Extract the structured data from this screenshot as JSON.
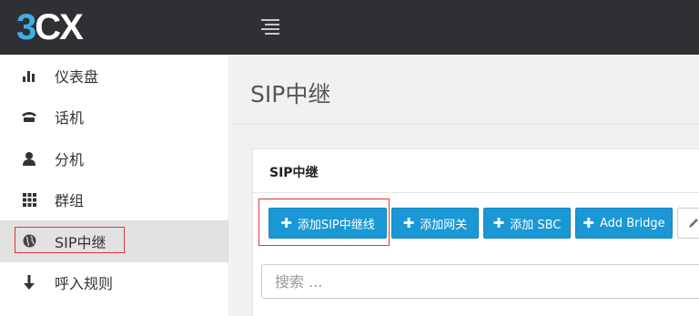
{
  "brand": {
    "logo_3": "3",
    "logo_c": "C",
    "logo_x": "X",
    "accent": "#3bb0e6",
    "topbar_bg": "#2f3033"
  },
  "topbar": {
    "menu_icon": "hamburger-icon"
  },
  "sidebar": {
    "items": [
      {
        "label": "仪表盘",
        "icon": "bar-chart-icon"
      },
      {
        "label": "话机",
        "icon": "phone-icon"
      },
      {
        "label": "分机",
        "icon": "user-icon"
      },
      {
        "label": "群组",
        "icon": "grid-icon"
      },
      {
        "label": "SIP中继",
        "icon": "globe-icon",
        "active": true
      },
      {
        "label": "呼入规则",
        "icon": "arrow-down-icon"
      }
    ]
  },
  "main": {
    "title": "SIP中继",
    "panel": {
      "title": "SIP中继",
      "buttons": {
        "add_sip": "添加SIP中继线",
        "add_gateway": "添加网关",
        "add_sbc": "添加 SBC",
        "add_bridge": "Add Bridge",
        "plus": "✚"
      },
      "search_placeholder": "搜索 ..."
    }
  },
  "colors": {
    "button_blue": "#1a98d5",
    "highlight_red": "#e23636"
  }
}
